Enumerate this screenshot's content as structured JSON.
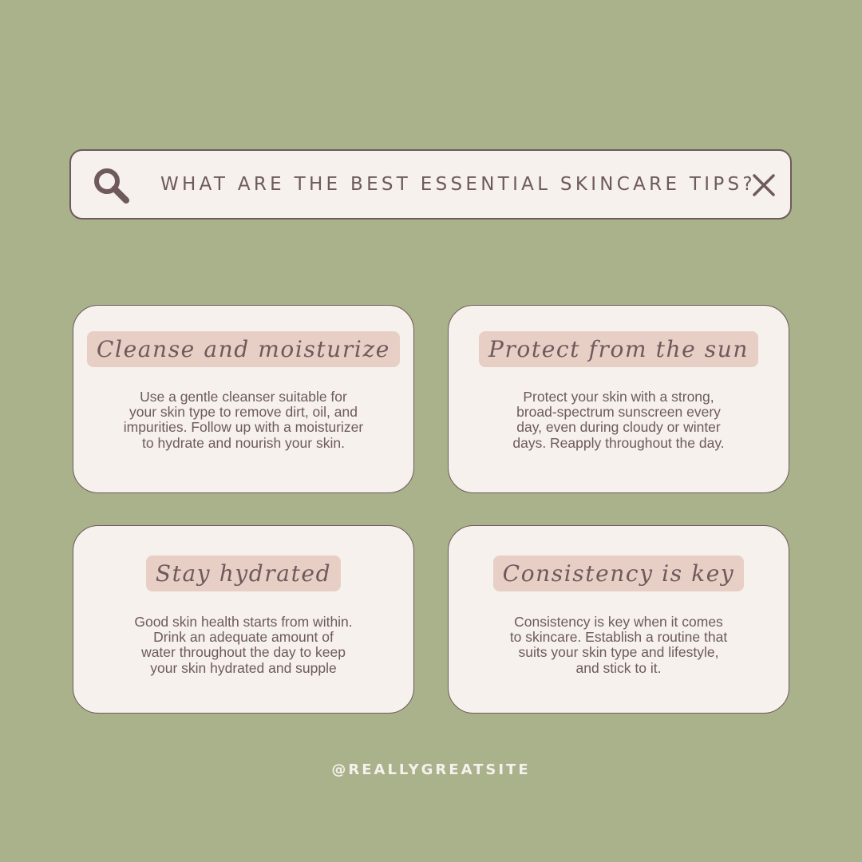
{
  "search": {
    "query": "WHAT ARE THE BEST ESSENTIAL SKINCARE TIPS?",
    "search_icon": "search-icon",
    "close_icon": "close-icon"
  },
  "cards": [
    {
      "title": "Cleanse and moisturize",
      "lines": [
        "Use a gentle cleanser suitable for",
        "your skin type to remove dirt, oil, and",
        "impurities. Follow up with a moisturizer",
        "to hydrate and nourish your skin."
      ]
    },
    {
      "title": "Protect from the sun",
      "lines": [
        "Protect your skin with a strong,",
        "broad-spectrum sunscreen every",
        "day, even during cloudy or winter",
        "days. Reapply throughout the day."
      ]
    },
    {
      "title": "Stay hydrated",
      "lines": [
        "Good skin health starts from within.",
        "Drink an adequate amount of",
        "water throughout the day to keep",
        "your skin hydrated and supple"
      ]
    },
    {
      "title": "Consistency is key",
      "lines": [
        "Consistency is key when it comes",
        "to skincare. Establish a routine that",
        "suits your skin type and lifestyle,",
        "and stick to it."
      ]
    }
  ],
  "footer": {
    "handle": "@REALLYGREATSITE"
  },
  "colors": {
    "background": "#a9b28a",
    "card_background": "#f6f1ed",
    "title_highlight": "#e7cfc5",
    "text": "#6e5a5c",
    "footer_text": "#f6f1ed"
  }
}
